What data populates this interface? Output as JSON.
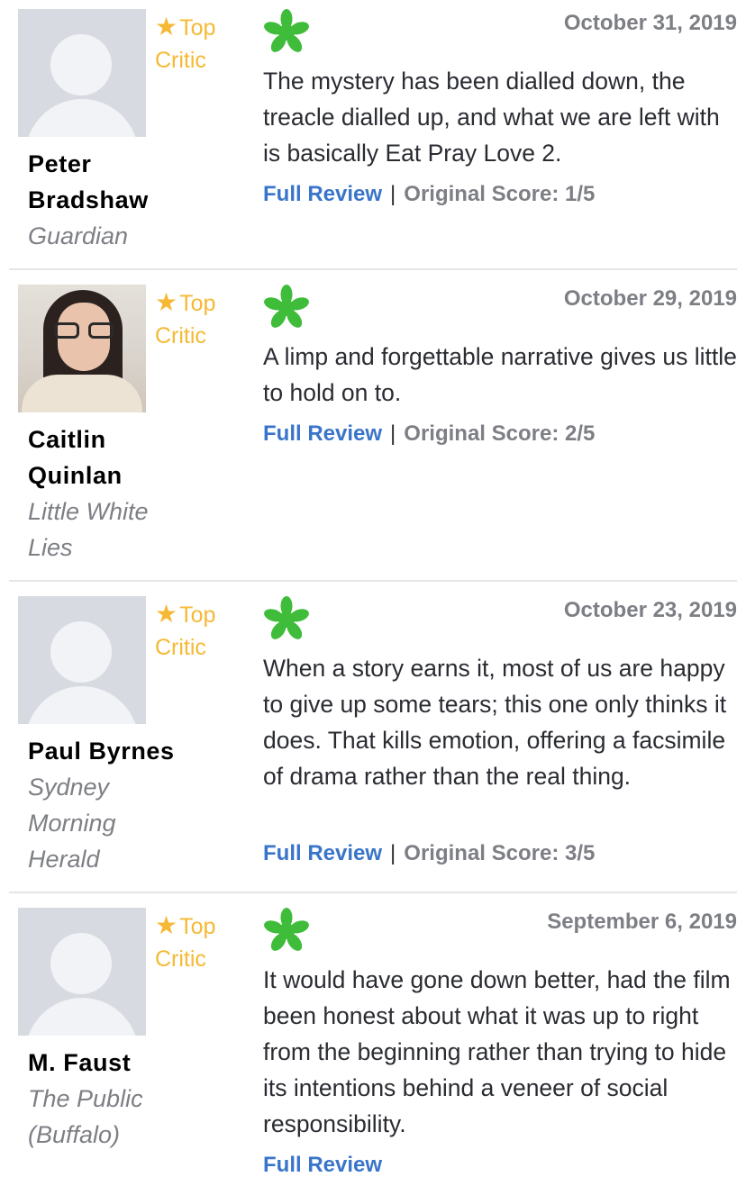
{
  "colors": {
    "top_critic": "#f5b935",
    "fresh_splat": "#3fbc3a",
    "link": "#3975c9",
    "muted": "#7d7f85"
  },
  "reviews": [
    {
      "top_critic_star": "★",
      "top_critic_label_1": "Top",
      "top_critic_label_2": "Critic",
      "avatar": "default-avatar",
      "critic_name_line1": "Peter",
      "critic_name_line2": "Bradshaw",
      "publication_line1": "Guardian",
      "date": "October 31, 2019",
      "rating_icon": "fresh-splat-icon",
      "quote": "The mystery has been dialled down, the treacle dialled up, and what we are left with is basically Eat Pray Love 2.",
      "full_review": "Full Review",
      "separator": "|",
      "original_score": "Original Score: 1/5"
    },
    {
      "top_critic_star": "★",
      "top_critic_label_1": "Top",
      "top_critic_label_2": "Critic",
      "avatar": "critic-photo",
      "critic_name_line1": "Caitlin",
      "critic_name_line2": "Quinlan",
      "publication_line1": "Little White",
      "publication_line2": "Lies",
      "date": "October 29, 2019",
      "rating_icon": "fresh-splat-icon",
      "quote": "A limp and forgettable narrative gives us little to hold on to.",
      "full_review": "Full Review",
      "separator": "|",
      "original_score": "Original Score: 2/5"
    },
    {
      "top_critic_star": "★",
      "top_critic_label_1": "Top",
      "top_critic_label_2": "Critic",
      "avatar": "default-avatar",
      "critic_name_line1": "Paul Byrnes",
      "publication_line1": "Sydney",
      "publication_line2": "Morning",
      "publication_line3": "Herald",
      "date": "October 23, 2019",
      "rating_icon": "fresh-splat-icon",
      "quote": "When a story earns it, most of us are happy to give up some tears; this one only thinks it does. That kills emotion, offering a facsimile of drama rather than the real thing.",
      "full_review": "Full Review",
      "separator": "|",
      "original_score": "Original Score: 3/5"
    },
    {
      "top_critic_star": "★",
      "top_critic_label_1": "Top",
      "top_critic_label_2": "Critic",
      "avatar": "default-avatar",
      "critic_name_line1": "M. Faust",
      "publication_line1": "The Public",
      "publication_line2": "(Buffalo)",
      "date": "September 6, 2019",
      "rating_icon": "fresh-splat-icon",
      "quote": "It would have gone down better, had the film been honest about what it was up to right from the beginning rather than trying to hide its intentions behind a veneer of social responsibility.",
      "full_review": "Full Review"
    }
  ]
}
